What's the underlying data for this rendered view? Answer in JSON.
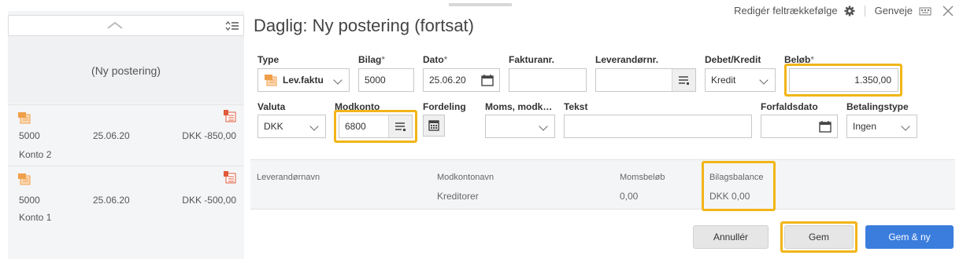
{
  "window": {
    "title": "Daglig: Ny postering (fortsat)"
  },
  "top_links": {
    "reorder": "Redigér feltrækkefølge",
    "shortcuts": "Genveje"
  },
  "sidebar": {
    "new_entry": "(Ny postering)",
    "items": [
      {
        "bilag": "5000",
        "date": "25.06.20",
        "amount": "DKK -850,00",
        "account": "Konto 2"
      },
      {
        "bilag": "5000",
        "date": "25.06.20",
        "amount": "DKK -500,00",
        "account": "Konto 1"
      }
    ]
  },
  "fields": {
    "type": {
      "label": "Type",
      "value": "Lev.faktu"
    },
    "bilag": {
      "label": "Bilag",
      "req": "*",
      "value": "5000"
    },
    "dato": {
      "label": "Dato",
      "req": "*",
      "value": "25.06.20"
    },
    "fakturanr": {
      "label": "Fakturanr.",
      "value": ""
    },
    "leverandornr": {
      "label": "Leverandørnr.",
      "value": ""
    },
    "debetkredit": {
      "label": "Debet/Kredit",
      "value": "Kredit"
    },
    "belob": {
      "label": "Beløb",
      "req": "*",
      "value": "1.350,00"
    },
    "valuta": {
      "label": "Valuta",
      "value": "DKK"
    },
    "modkonto": {
      "label": "Modkonto",
      "value": "6800"
    },
    "fordeling": {
      "label": "Fordeling"
    },
    "moms": {
      "label": "Moms, modk…",
      "value": ""
    },
    "tekst": {
      "label": "Tekst",
      "value": ""
    },
    "forfaldsdato": {
      "label": "Forfaldsdato",
      "value": ""
    },
    "betalingstype": {
      "label": "Betalingstype",
      "value": "Ingen"
    }
  },
  "info": {
    "leverandornavn": {
      "label": "Leverandørnavn",
      "value": ""
    },
    "modkontonavn": {
      "label": "Modkontonavn",
      "value": "Kreditorer"
    },
    "momsbelob": {
      "label": "Momsbeløb",
      "value": "0,00"
    },
    "bilagsbalance": {
      "label": "Bilagsbalance",
      "value": "DKK 0,00"
    }
  },
  "buttons": {
    "cancel": "Annullér",
    "save": "Gem",
    "save_new": "Gem & ny"
  },
  "colors": {
    "highlight": "#f2b518",
    "primary": "#3b7ddd",
    "icon_orange": "#f0a04b",
    "icon_red": "#e05a3a"
  }
}
